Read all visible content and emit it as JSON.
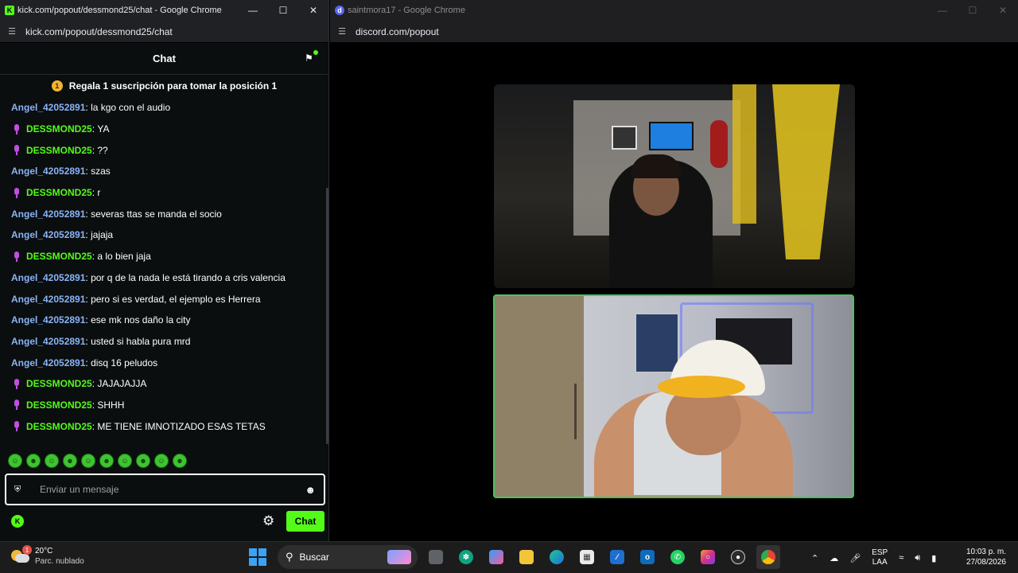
{
  "kick_window": {
    "title": "kick.com/popout/dessmond25/chat - Google Chrome",
    "url": "kick.com/popout/dessmond25/chat",
    "chat_title": "Chat",
    "pinned_banner": "Regala 1 suscripción para tomar la posición 1",
    "pinned_rank": "1",
    "messages": [
      {
        "user": "Angel_42052891",
        "sep": ": ",
        "text": "la kgo con el audio"
      },
      {
        "user": "DESSMOND25",
        "sep": ": ",
        "text": "YA"
      },
      {
        "user": "DESSMOND25",
        "sep": ": ",
        "text": "??"
      },
      {
        "user": "Angel_42052891",
        "sep": ": ",
        "text": "szas"
      },
      {
        "user": "DESSMOND25",
        "sep": ": ",
        "text": "r"
      },
      {
        "user": "Angel_42052891",
        "sep": ": ",
        "text": "severas ttas se manda el socio"
      },
      {
        "user": "Angel_42052891",
        "sep": ": ",
        "text": "jajaja"
      },
      {
        "user": "DESSMOND25",
        "sep": ": ",
        "text": "a lo bien jaja"
      },
      {
        "user": "Angel_42052891",
        "sep": ": ",
        "text": "por q de la nada le está tirando a cris valencia"
      },
      {
        "user": "Angel_42052891",
        "sep": ": ",
        "text": "pero si es verdad, el ejemplo es Herrera"
      },
      {
        "user": "Angel_42052891",
        "sep": ": ",
        "text": "ese mk nos daño la city"
      },
      {
        "user": "Angel_42052891",
        "sep": ": ",
        "text": "usted si habla pura mrd"
      },
      {
        "user": "Angel_42052891",
        "sep": ": ",
        "text": "disq 16 peludos"
      },
      {
        "user": "DESSMOND25",
        "sep": ": ",
        "text": "JAJAJAJJA"
      },
      {
        "user": "DESSMOND25",
        "sep": ": ",
        "text": "SHHH"
      },
      {
        "user": "DESSMOND25",
        "sep": ": ",
        "text": "ME TIENE IMNOTIZADO ESAS TETAS"
      }
    ],
    "input_placeholder": "Enviar un mensaje",
    "send_button": "Chat"
  },
  "discord_window": {
    "title": "saintmora17 - Google Chrome",
    "url": "discord.com/popout"
  },
  "taskbar": {
    "temperature": "20°C",
    "condition": "Parc. nublado",
    "weather_badge": "1",
    "search_label": "Buscar",
    "lang_line1": "ESP",
    "lang_line2": "LAA",
    "time": "10:03 p. m.",
    "date": "27/08/2026"
  },
  "colors": {
    "kick_green": "#53fc18",
    "angel_blue": "#8ab4f8",
    "mic_purple": "#c04fe0",
    "active_video_border": "#48c55b"
  }
}
